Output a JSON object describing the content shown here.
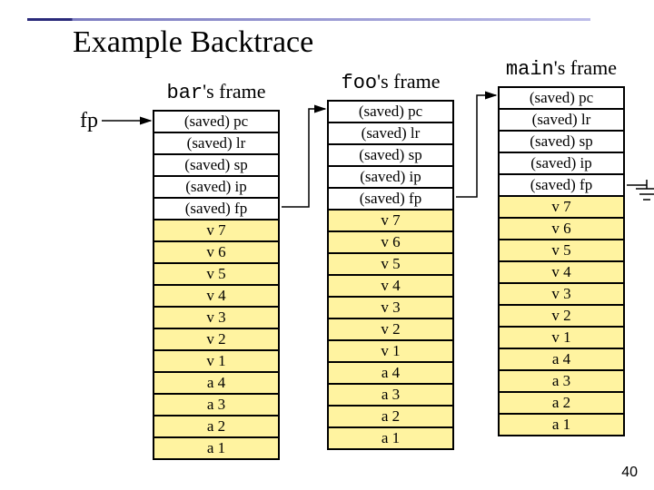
{
  "slide": {
    "title": "Example Backtrace",
    "page_number": "40"
  },
  "fp_label": "fp",
  "frames": [
    {
      "name": "bar",
      "label_code": "bar",
      "label_suffix": "'s frame",
      "saved": [
        "(saved) pc",
        "(saved) lr",
        "(saved) sp",
        "(saved) ip",
        "(saved) fp"
      ],
      "locals": [
        "v 7",
        "v 6",
        "v 5",
        "v 4",
        "v 3",
        "v 2",
        "v 1",
        "a 4",
        "a 3",
        "a 2",
        "a 1"
      ]
    },
    {
      "name": "foo",
      "label_code": "foo",
      "label_suffix": "'s frame",
      "saved": [
        "(saved) pc",
        "(saved) lr",
        "(saved) sp",
        "(saved) ip",
        "(saved) fp"
      ],
      "locals": [
        "v 7",
        "v 6",
        "v 5",
        "v 4",
        "v 3",
        "v 2",
        "v 1",
        "a 4",
        "a 3",
        "a 2",
        "a 1"
      ]
    },
    {
      "name": "main",
      "label_code": "main",
      "label_suffix": "'s frame",
      "saved": [
        "(saved) pc",
        "(saved) lr",
        "(saved) sp",
        "(saved) ip",
        "(saved) fp"
      ],
      "locals": [
        "v 7",
        "v 6",
        "v 5",
        "v 4",
        "v 3",
        "v 2",
        "v 1",
        "a 4",
        "a 3",
        "a 2",
        "a 1"
      ]
    }
  ]
}
